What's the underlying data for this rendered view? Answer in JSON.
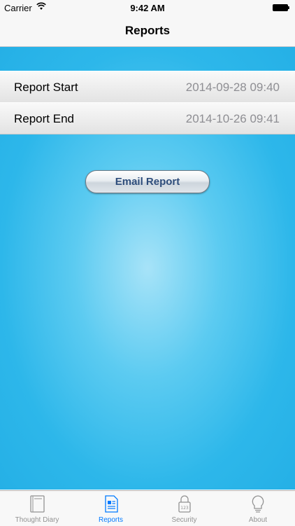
{
  "status_bar": {
    "carrier": "Carrier",
    "time": "9:42 AM"
  },
  "nav": {
    "title": "Reports"
  },
  "report": {
    "rows": [
      {
        "label": "Report Start",
        "value": "2014-09-28 09:40"
      },
      {
        "label": "Report End",
        "value": "2014-10-26 09:41"
      }
    ],
    "email_button": "Email Report"
  },
  "tab_bar": {
    "tabs": [
      {
        "label": "Thought Diary",
        "icon": "notebook-icon",
        "active": false
      },
      {
        "label": "Reports",
        "icon": "document-icon",
        "active": true
      },
      {
        "label": "Security",
        "icon": "lock-icon",
        "active": false
      },
      {
        "label": "About",
        "icon": "lightbulb-icon",
        "active": false
      }
    ]
  },
  "colors": {
    "accent": "#007aff",
    "background": "#2db7ea",
    "button_text": "#2e4d7b"
  }
}
